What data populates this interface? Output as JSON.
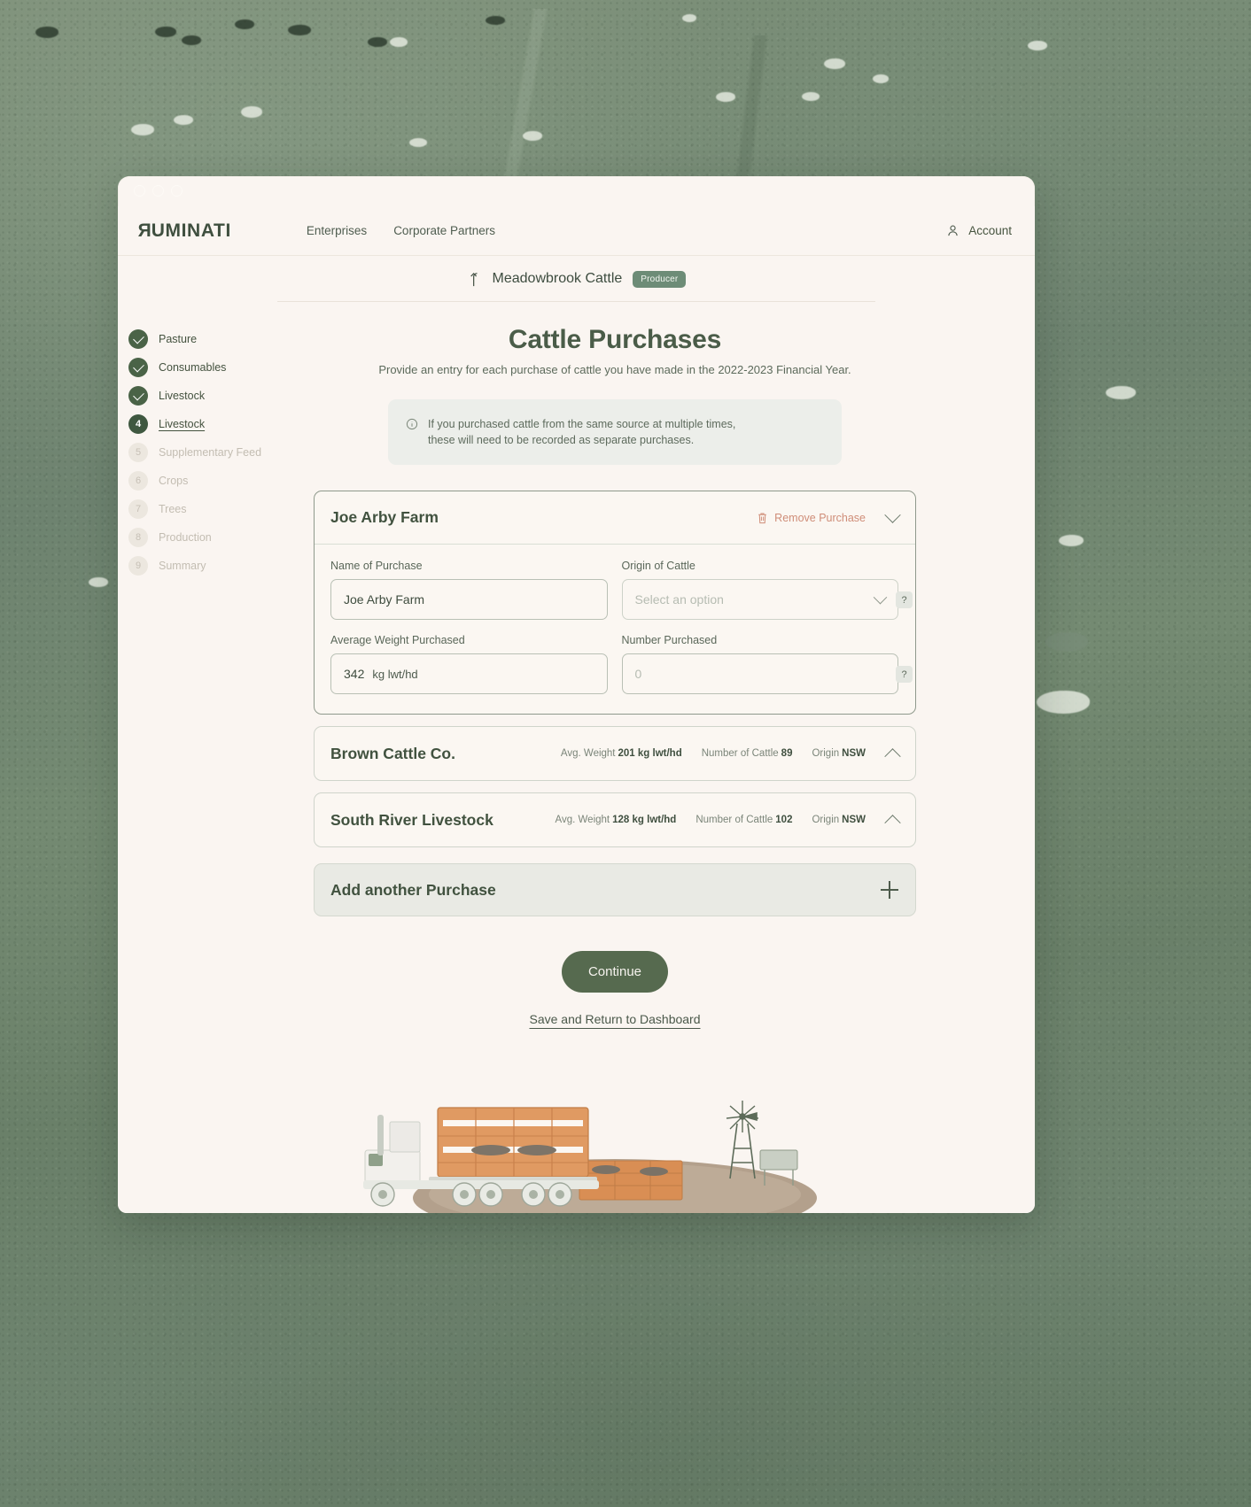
{
  "window": {
    "dots": [
      "close",
      "minimize",
      "maximize"
    ]
  },
  "topnav": {
    "logo": "RUMINATI",
    "links": [
      {
        "label": "Enterprises"
      },
      {
        "label": "Corporate Partners"
      }
    ],
    "account_label": "Account",
    "account_icon": "user-icon"
  },
  "farmbar": {
    "back_icon": "return-arrow-icon",
    "name": "Meadowbrook Cattle",
    "badge": "Producer",
    "badge_color": "#6d8c77"
  },
  "sidebar": {
    "steps": [
      {
        "marker": "✓",
        "label": "Pasture",
        "state": "done"
      },
      {
        "marker": "✓",
        "label": "Consumables",
        "state": "done"
      },
      {
        "marker": "✓",
        "label": "Livestock",
        "state": "done"
      },
      {
        "marker": "4",
        "label": "Livestock",
        "state": "current"
      },
      {
        "marker": "5",
        "label": "Supplementary Feed",
        "state": "todo"
      },
      {
        "marker": "6",
        "label": "Crops",
        "state": "todo"
      },
      {
        "marker": "7",
        "label": "Trees",
        "state": "todo"
      },
      {
        "marker": "8",
        "label": "Production",
        "state": "todo"
      },
      {
        "marker": "9",
        "label": "Summary",
        "state": "todo"
      }
    ]
  },
  "main": {
    "title": "Cattle Purchases",
    "subtitle": "Provide an entry for each purchase of cattle you have made in the 2022-2023 Financial Year.",
    "notice": {
      "icon": "info-icon",
      "line1": "If you purchased cattle from the same source at multiple times,",
      "line2": "these will need to be recorded as separate purchases."
    },
    "expanded_card": {
      "title": "Joe Arby Farm",
      "remove_label": "Remove Purchase",
      "remove_icon": "trash-icon",
      "chevron_icon": "chevron-down-icon",
      "fields": {
        "name_label": "Name of Purchase",
        "name_value": "Joe Arby Farm",
        "origin_label": "Origin of Cattle",
        "origin_placeholder": "Select an option",
        "origin_help": "?",
        "weight_label": "Average Weight Purchased",
        "weight_value": "342",
        "weight_unit": "kg lwt/hd",
        "number_label": "Number Purchased",
        "number_placeholder": "0",
        "number_help": "?"
      }
    },
    "collapsed_cards": [
      {
        "title": "Brown Cattle Co.",
        "meta": [
          {
            "label": "Avg. Weight",
            "value": "201 kg lwt/hd"
          },
          {
            "label": "Number of Cattle",
            "value": "89"
          },
          {
            "label": "Origin",
            "value": "NSW"
          }
        ],
        "chevron_icon": "chevron-up-icon"
      },
      {
        "title": "South River Livestock",
        "meta": [
          {
            "label": "Avg. Weight",
            "value": "128 kg lwt/hd"
          },
          {
            "label": "Number of Cattle",
            "value": "102"
          },
          {
            "label": "Origin",
            "value": "NSW"
          }
        ],
        "chevron_icon": "chevron-up-icon"
      }
    ],
    "add_card": {
      "label": "Add another Purchase",
      "icon": "plus-icon"
    },
    "continue_label": "Continue",
    "save_link_label": "Save and Return to Dashboard"
  },
  "illustration": {
    "name": "cattle-truck-windmill-illustration",
    "colors": {
      "crate": "#d98e54",
      "ground": "#b09a86",
      "truck": "#f2f0ec",
      "windmill": "#5d6b59"
    }
  },
  "theme": {
    "page_bg": "#faf5f1",
    "primary": "#566a4f",
    "text": "#41523f",
    "danger": "#cf8d78"
  }
}
